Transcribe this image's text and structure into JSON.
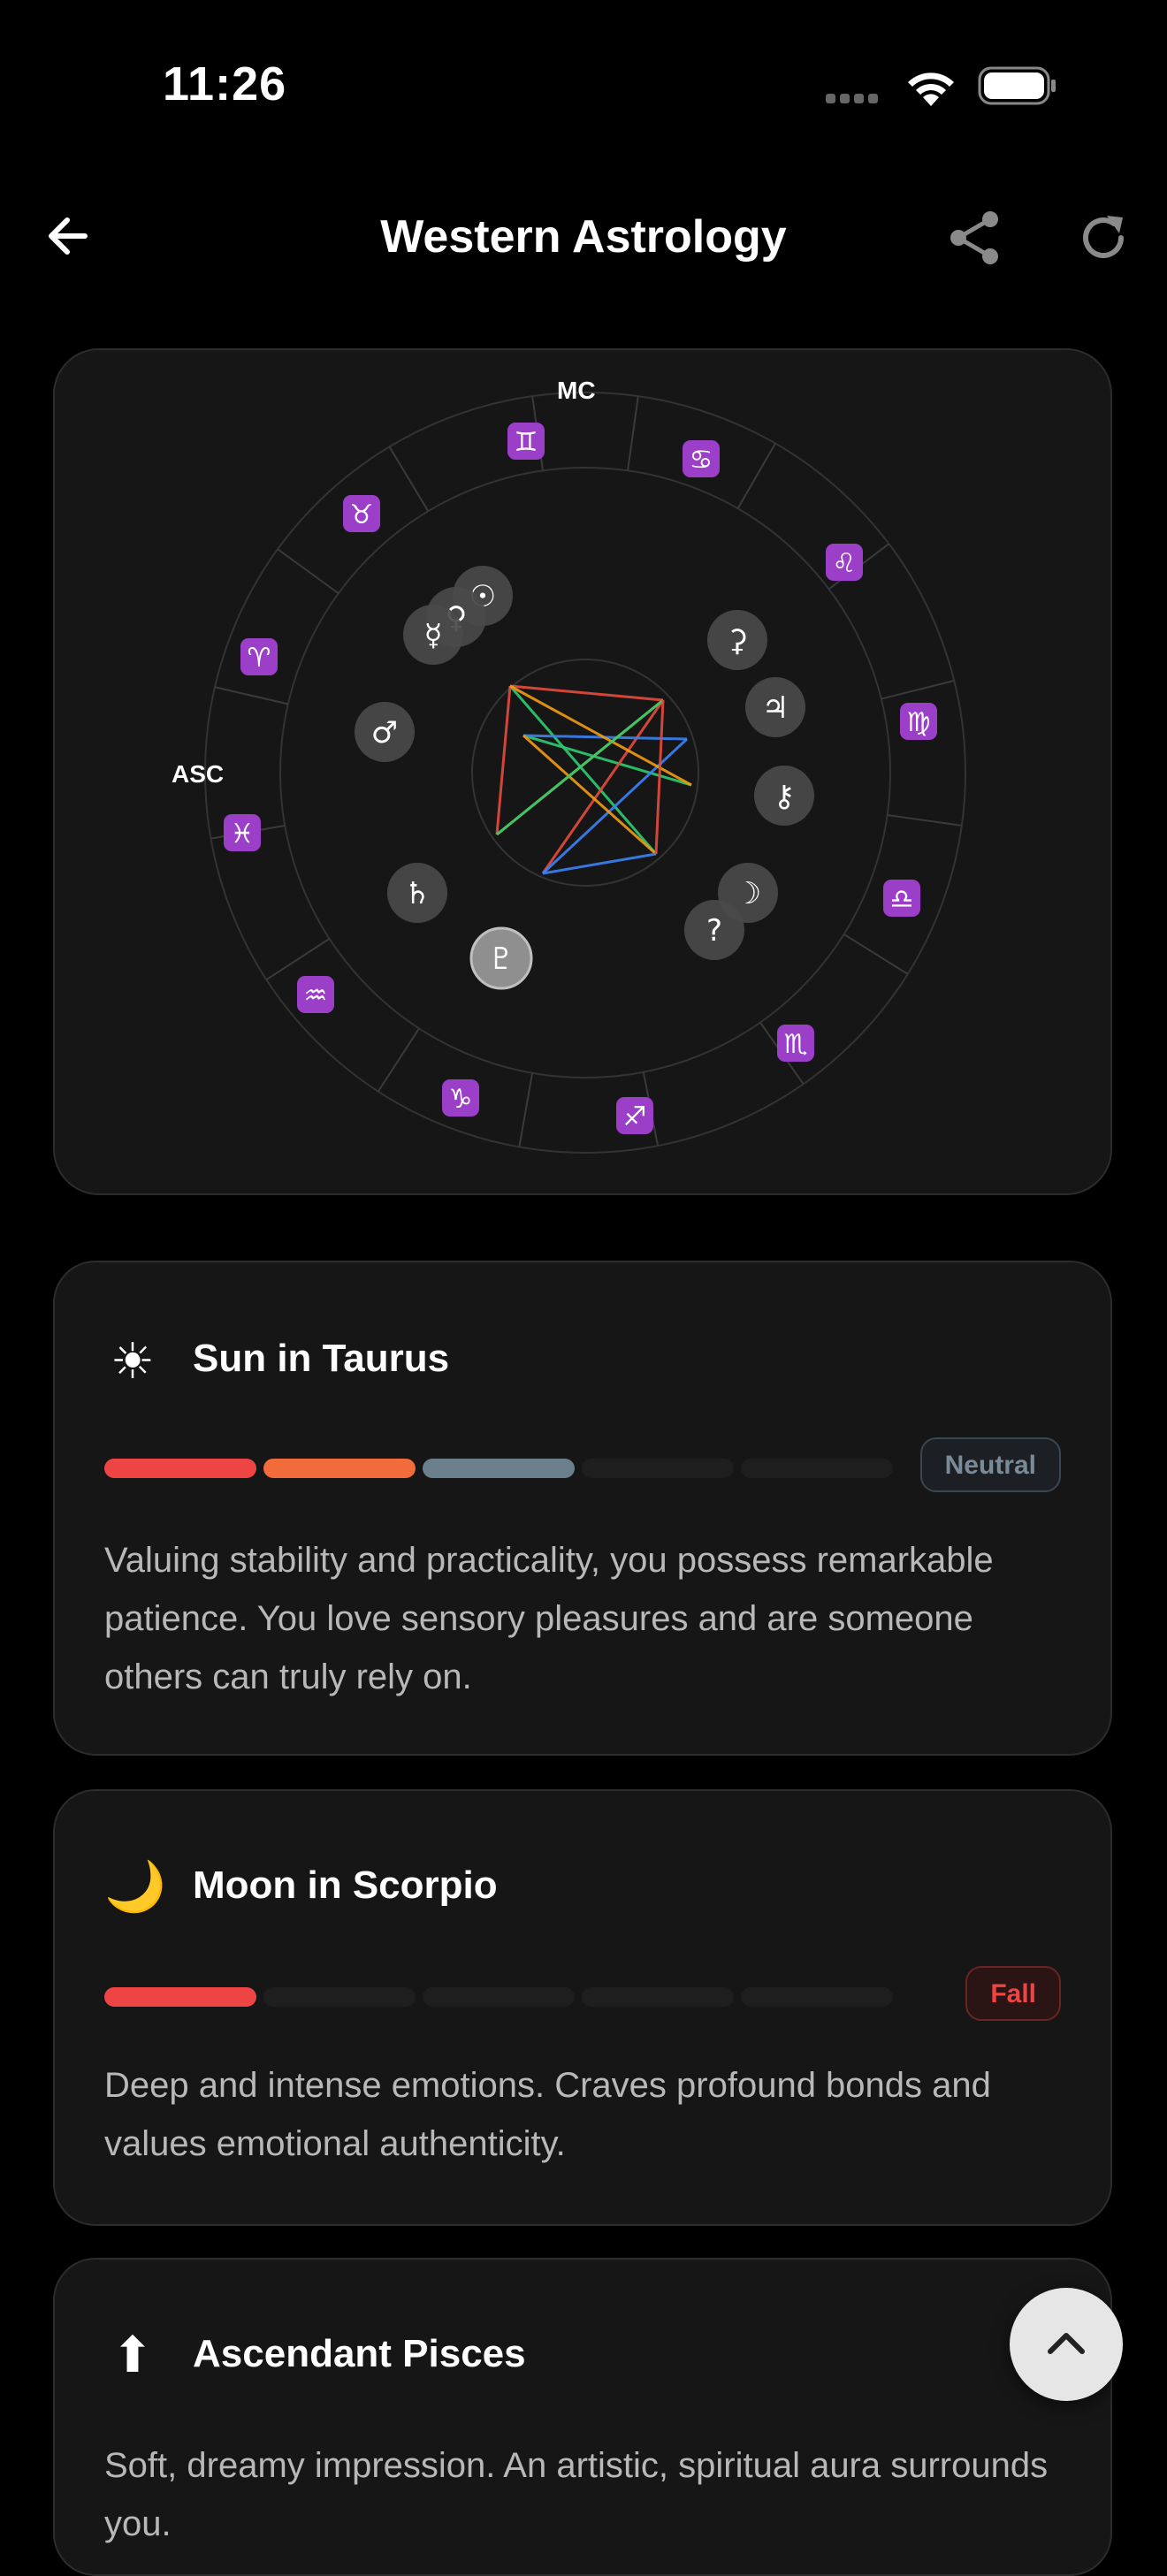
{
  "status_bar": {
    "time": "11:26"
  },
  "header": {
    "title": "Western Astrology"
  },
  "chart": {
    "mc_label": "MC",
    "asc_label": "ASC",
    "signs": [
      {
        "name": "aries",
        "glyph": "♈"
      },
      {
        "name": "taurus",
        "glyph": "♉"
      },
      {
        "name": "gemini",
        "glyph": "♊"
      },
      {
        "name": "cancer",
        "glyph": "♋"
      },
      {
        "name": "leo",
        "glyph": "♌"
      },
      {
        "name": "virgo",
        "glyph": "♍"
      },
      {
        "name": "libra",
        "glyph": "♎"
      },
      {
        "name": "scorpio",
        "glyph": "♏"
      },
      {
        "name": "sagittarius",
        "glyph": "♐"
      },
      {
        "name": "capricorn",
        "glyph": "♑"
      },
      {
        "name": "aquarius",
        "glyph": "♒"
      },
      {
        "name": "pisces",
        "glyph": "♓"
      }
    ],
    "planets": [
      {
        "name": "sun",
        "glyph": "☉"
      },
      {
        "name": "venus",
        "glyph": "♀"
      },
      {
        "name": "mercury",
        "glyph": "☿"
      },
      {
        "name": "mars",
        "glyph": "♂"
      },
      {
        "name": "ceres",
        "glyph": "⚳"
      },
      {
        "name": "jupiter",
        "glyph": "♃"
      },
      {
        "name": "chiron",
        "glyph": "⚷"
      },
      {
        "name": "moon",
        "glyph": "☽"
      },
      {
        "name": "unknown",
        "glyph": "?"
      },
      {
        "name": "saturn",
        "glyph": "♄"
      },
      {
        "name": "pluto",
        "glyph": "♇"
      }
    ],
    "aspect_colors": [
      "#e74c3c",
      "#2ecc71",
      "#3b82f6",
      "#f39c12"
    ]
  },
  "cards": [
    {
      "icon": "☀",
      "title": "Sun in Taurus",
      "badge": "Neutral",
      "badge_color": "#7a8a96",
      "filled_segments": 3,
      "total_segments": 5,
      "segment_colors": [
        "#ef4444",
        "#f26b3a",
        "#6b7f8c"
      ],
      "text": "Valuing stability and practicality, you possess remarkable patience. You love sensory pleasures and are someone others can truly rely on."
    },
    {
      "icon": "🌙",
      "title": "Moon in Scorpio",
      "badge": "Fall",
      "badge_color": "#ef4444",
      "filled_segments": 1,
      "total_segments": 5,
      "segment_colors": [
        "#ef4444"
      ],
      "text": "Deep and intense emotions. Craves profound bonds and values emotional authenticity."
    },
    {
      "icon": "⬆",
      "title": "Ascendant Pisces",
      "text": "Soft, dreamy impression. An artistic, spiritual aura surrounds you."
    }
  ]
}
